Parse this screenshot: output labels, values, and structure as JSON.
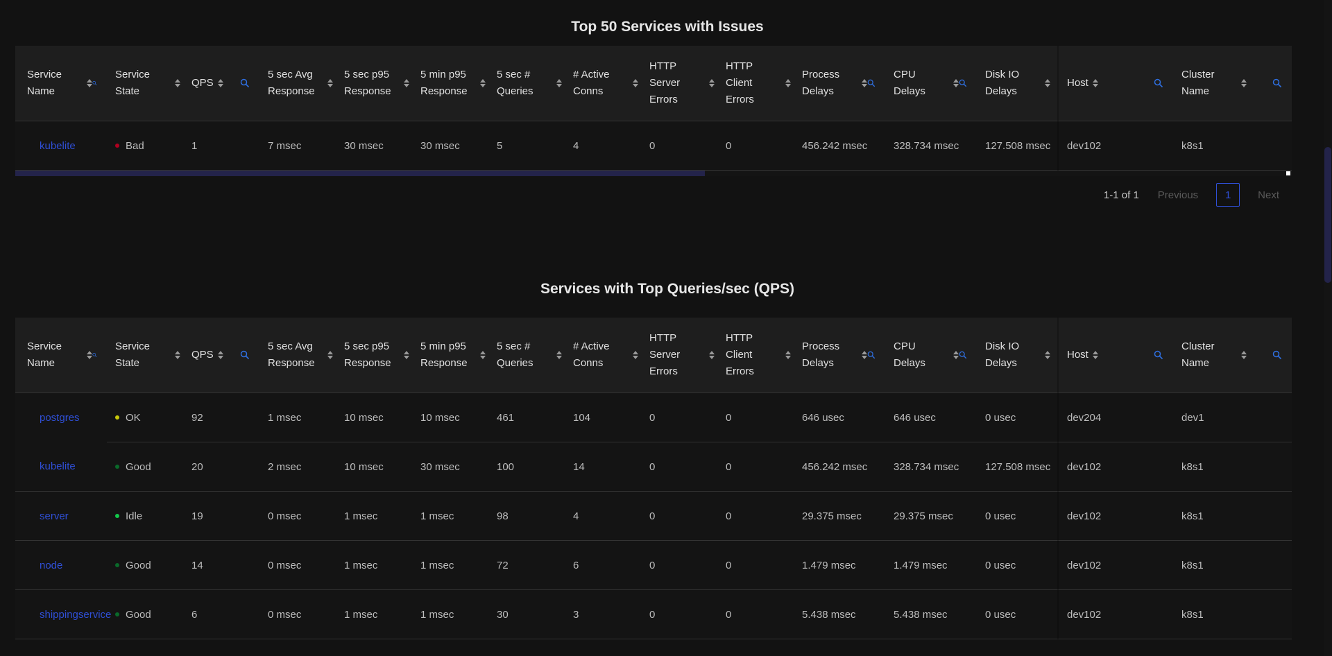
{
  "columns": [
    {
      "key": "name",
      "label": "Service Name"
    },
    {
      "key": "state",
      "label": "Service State"
    },
    {
      "key": "qps",
      "label": "QPS"
    },
    {
      "key": "avg5s",
      "label": "5 sec Avg Response"
    },
    {
      "key": "p95_5s",
      "label": "5 sec p95 Response"
    },
    {
      "key": "p95_5m",
      "label": "5 min p95 Response"
    },
    {
      "key": "queries5s",
      "label": "5 sec # Queries"
    },
    {
      "key": "conns",
      "label": "# Active Conns"
    },
    {
      "key": "srvErr",
      "label": "HTTP Server Errors"
    },
    {
      "key": "cliErr",
      "label": "HTTP Client Errors"
    },
    {
      "key": "procDelay",
      "label": "Process Delays"
    },
    {
      "key": "cpuDelay",
      "label": "CPU Delays"
    },
    {
      "key": "diskDelay",
      "label": "Disk IO Delays"
    },
    {
      "key": "host",
      "label": "Host"
    },
    {
      "key": "cluster",
      "label": "Cluster Name"
    }
  ],
  "state_colors": {
    "Bad": "#b00020",
    "OK": "#c8c80a",
    "Good": "#0a6a2a",
    "Idle": "#12c84a"
  },
  "issues_table": {
    "title": "Top 50 Services with Issues",
    "rows": [
      {
        "name": "kubelite",
        "state": "Bad",
        "qps": "1",
        "avg5s": "7 msec",
        "p95_5s": "30 msec",
        "p95_5m": "30 msec",
        "queries5s": "5",
        "conns": "4",
        "srvErr": "0",
        "cliErr": "0",
        "procDelay": "456.242 msec",
        "cpuDelay": "328.734 msec",
        "diskDelay": "127.508 msec",
        "host": "dev102",
        "cluster": "k8s1"
      }
    ],
    "pagination": {
      "info": "1-1 of 1",
      "previous": "Previous",
      "current_page": "1",
      "next": "Next"
    },
    "hscroll_fraction": 0.54
  },
  "qps_table": {
    "title": "Services with Top Queries/sec (QPS)",
    "rows": [
      {
        "name": "postgres",
        "state": "OK",
        "qps": "92",
        "avg5s": "1 msec",
        "p95_5s": "10 msec",
        "p95_5m": "10 msec",
        "queries5s": "461",
        "conns": "104",
        "srvErr": "0",
        "cliErr": "0",
        "procDelay": "646 usec",
        "cpuDelay": "646 usec",
        "diskDelay": "0 usec",
        "host": "dev204",
        "cluster": "dev1"
      },
      {
        "name": "kubelite",
        "state": "Good",
        "qps": "20",
        "avg5s": "2 msec",
        "p95_5s": "10 msec",
        "p95_5m": "30 msec",
        "queries5s": "100",
        "conns": "14",
        "srvErr": "0",
        "cliErr": "0",
        "procDelay": "456.242 msec",
        "cpuDelay": "328.734 msec",
        "diskDelay": "127.508 msec",
        "host": "dev102",
        "cluster": "k8s1"
      },
      {
        "name": "server",
        "state": "Idle",
        "qps": "19",
        "avg5s": "0 msec",
        "p95_5s": "1 msec",
        "p95_5m": "1 msec",
        "queries5s": "98",
        "conns": "4",
        "srvErr": "0",
        "cliErr": "0",
        "procDelay": "29.375 msec",
        "cpuDelay": "29.375 msec",
        "diskDelay": "0 usec",
        "host": "dev102",
        "cluster": "k8s1"
      },
      {
        "name": "node",
        "state": "Good",
        "qps": "14",
        "avg5s": "0 msec",
        "p95_5s": "1 msec",
        "p95_5m": "1 msec",
        "queries5s": "72",
        "conns": "6",
        "srvErr": "0",
        "cliErr": "0",
        "procDelay": "1.479 msec",
        "cpuDelay": "1.479 msec",
        "diskDelay": "0 usec",
        "host": "dev102",
        "cluster": "k8s1"
      },
      {
        "name": "shippingservice",
        "state": "Good",
        "qps": "6",
        "avg5s": "0 msec",
        "p95_5s": "1 msec",
        "p95_5m": "1 msec",
        "queries5s": "30",
        "conns": "3",
        "srvErr": "0",
        "cliErr": "0",
        "procDelay": "5.438 msec",
        "cpuDelay": "5.438 msec",
        "diskDelay": "0 usec",
        "host": "dev102",
        "cluster": "k8s1"
      }
    ]
  },
  "icons": {
    "sort": "sort-icon",
    "search": "search-icon"
  }
}
